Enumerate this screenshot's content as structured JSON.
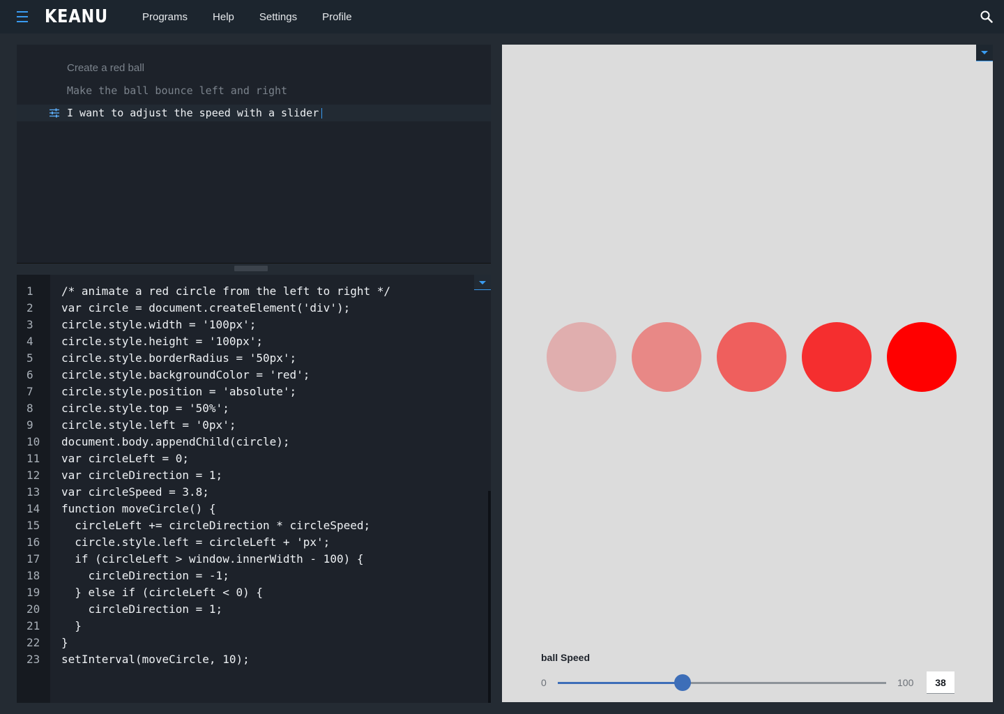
{
  "app": {
    "logo": "KEANU"
  },
  "nav": {
    "items": [
      "Programs",
      "Help",
      "Settings",
      "Profile"
    ]
  },
  "prompts": [
    "Create a red ball",
    "Make the ball bounce left and right",
    "I want to adjust the speed with a slider"
  ],
  "code": {
    "lines": [
      "/* animate a red circle from the left to right */",
      "var circle = document.createElement('div');",
      "circle.style.width = '100px';",
      "circle.style.height = '100px';",
      "circle.style.borderRadius = '50px';",
      "circle.style.backgroundColor = 'red';",
      "circle.style.position = 'absolute';",
      "circle.style.top = '50%';",
      "circle.style.left = '0px';",
      "document.body.appendChild(circle);",
      "var circleLeft = 0;",
      "var circleDirection = 1;",
      "var circleSpeed = 3.8;",
      "function moveCircle() {",
      "  circleLeft += circleDirection * circleSpeed;",
      "  circle.style.left = circleLeft + 'px';",
      "  if (circleLeft > window.innerWidth - 100) {",
      "    circleDirection = -1;",
      "  } else if (circleLeft < 0) {",
      "    circleDirection = 1;",
      "  }",
      "}",
      "setInterval(moveCircle, 10);"
    ]
  },
  "preview": {
    "ball_colors": [
      "#e0aeae",
      "#e88886",
      "#ef5f5d",
      "#f52e2f",
      "#ff0000"
    ],
    "slider": {
      "label": "ball Speed",
      "min": "0",
      "max": "100",
      "value": "38",
      "fraction": 0.38
    }
  },
  "colors": {
    "accent": "#3a9bf0",
    "slider_blue": "#3d6eb8"
  },
  "icons": {
    "menu": "hamburger-icon",
    "search": "search-icon",
    "prompt": "sliders-icon",
    "dropdown": "chevron-down-icon"
  }
}
